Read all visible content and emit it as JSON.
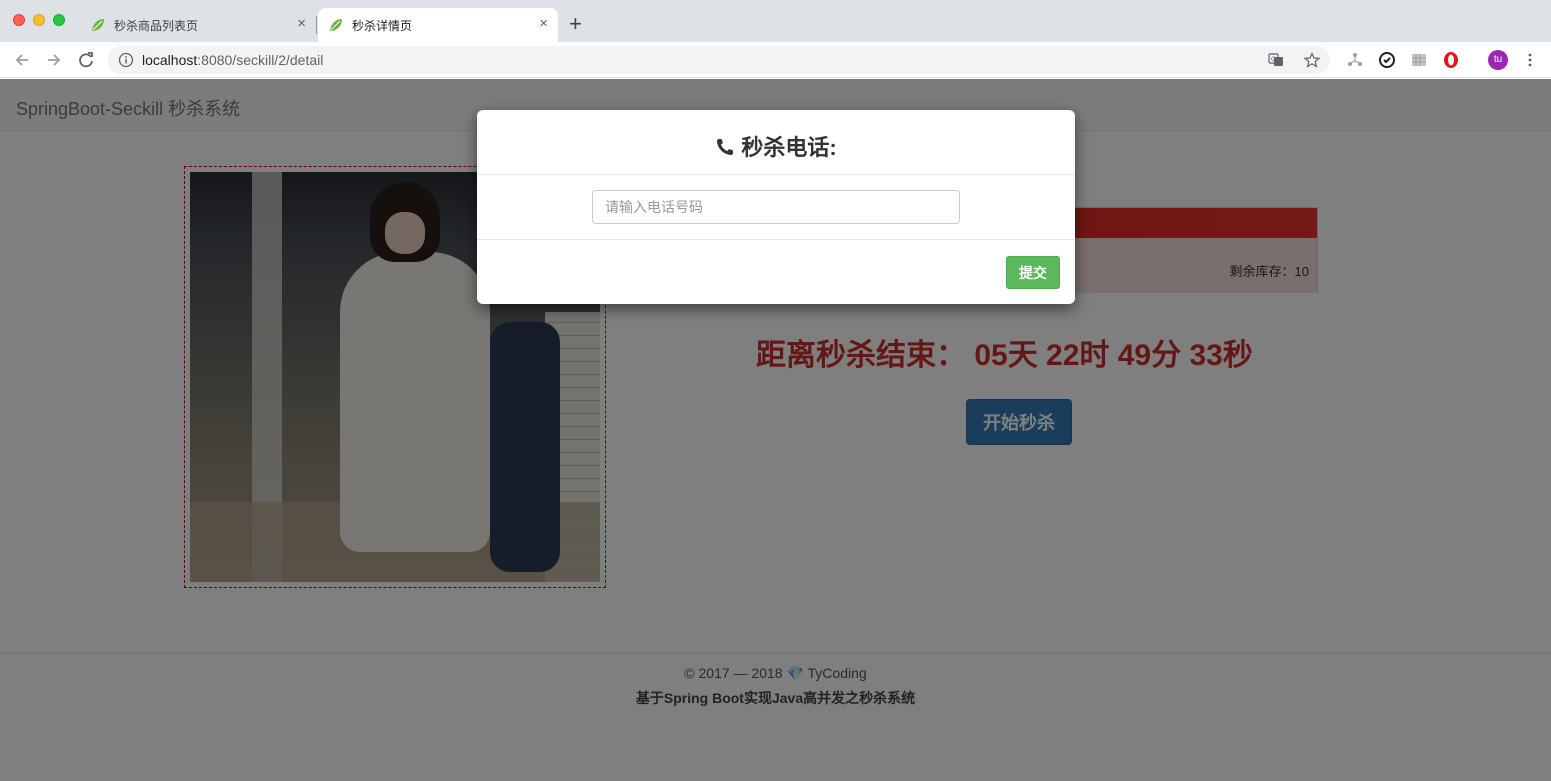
{
  "browser": {
    "tabs": [
      {
        "title": "秒杀商品列表页",
        "close": "×",
        "active": false
      },
      {
        "title": "秒杀详情页",
        "close": "×",
        "active": true
      }
    ],
    "new_tab": "+",
    "url": {
      "host": "localhost",
      "rest": ":8080/seckill/2/detail"
    },
    "avatar": "tu",
    "colors": {
      "avatar": "#9c27b0",
      "tabbar": "#dee1e6"
    }
  },
  "navbar": {
    "brand": "SpringBoot-Seckill 秒杀系统"
  },
  "detail": {
    "stock_label": "剩余库存：10",
    "countdown": "距离秒杀结束： 05天 22时 49分 33秒",
    "start_button": "开始秒杀",
    "colors": {
      "panel_head": "#d9201f",
      "panel_body": "#f2dede",
      "countdown": "#c9302c",
      "primary": "#337ab7"
    }
  },
  "footer": {
    "copyright": "© 2017 — 2018 💎 TyCoding",
    "subtitle": "基于Spring Boot实现Java高并发之秒杀系统"
  },
  "modal": {
    "title": "秒杀电话:",
    "icon": "phone-icon",
    "input": {
      "value": "",
      "placeholder": "请输入电话号码"
    },
    "submit": "提交",
    "colors": {
      "submit": "#5cb85c"
    }
  }
}
